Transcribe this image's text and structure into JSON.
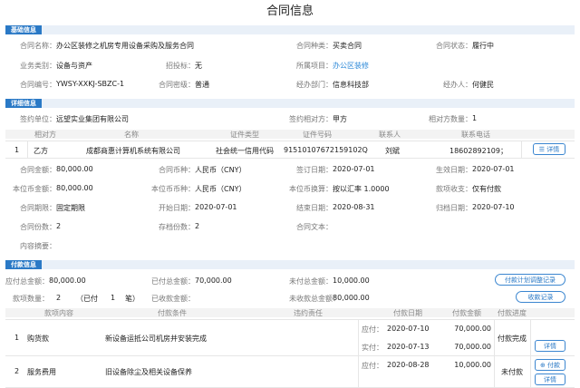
{
  "page_title": "合同信息",
  "sections": {
    "basic": "基础信息",
    "detail": "详细信息",
    "payment": "付款信息"
  },
  "basic": {
    "contract_name_label": "合同名称：",
    "contract_name": "办公区装修之机房专用设备采购及服务合同",
    "contract_type_label": "合同种类：",
    "contract_type": "买卖合同",
    "contract_status_label": "合同状态：",
    "contract_status": "履行中",
    "business_type_label": "业务类别：",
    "business_type": "设备与资产",
    "bid_label": "招投标：",
    "bid": "无",
    "project_label": "所属项目：",
    "project": "办公区装修",
    "contract_no_label": "合同编号：",
    "contract_no": "YWSY-XXKJ-SBZC-1",
    "secret_label": "合同密级：",
    "secret": "普通",
    "dept_label": "经办部门：",
    "dept": "信息科技部",
    "handler_label": "经办人：",
    "handler": "何健民"
  },
  "detail": {
    "sign_unit_label": "签约单位：",
    "sign_unit": "远望实业集团有限公司",
    "sign_party_label": "签约相对方：",
    "sign_party": "甲方",
    "counterparty_count_label": "相对方数量：",
    "counterparty_count": "1",
    "table_headers": [
      "相对方",
      "名称",
      "证件类型",
      "证件号码",
      "联系人",
      "联系电话"
    ],
    "table_row": {
      "index": "1",
      "party": "乙方",
      "name": "成都商惠计算机系统有限公司",
      "id_type": "社会统一信用代码",
      "id_no": "91510107672159102Q",
      "contact": "刘斌",
      "phone": "18602892109；",
      "detail_btn": "详情"
    },
    "fields": [
      {
        "label": "合同金额：",
        "value": "80,000.00"
      },
      {
        "label": "合同币种：",
        "value": "人民币（CNY）"
      },
      {
        "label": "签订日期：",
        "value": "2020-07-01"
      },
      {
        "label": "生效日期：",
        "value": "2020-07-01"
      },
      {
        "label": "本位币金额：",
        "value": "80,000.00"
      },
      {
        "label": "本位币币种：",
        "value": "人民币（CNY）"
      },
      {
        "label": "本位币换算：",
        "value": "按以汇率 1.0000"
      },
      {
        "label": "款项收支：",
        "value": "仅有付款"
      },
      {
        "label": "合同期限：",
        "value": "固定期限"
      },
      {
        "label": "开始日期：",
        "value": "2020-07-01"
      },
      {
        "label": "结束日期：",
        "value": "2020-08-31"
      },
      {
        "label": "归档日期：",
        "value": "2020-07-10"
      },
      {
        "label": "合同份数：",
        "value": "2"
      },
      {
        "label": "存档份数：",
        "value": "2"
      },
      {
        "label": "合同文本：",
        "value": ""
      }
    ],
    "content_summary_label": "内容摘要："
  },
  "payment": {
    "payable_total_label": "应付总金额：",
    "payable_total": "80,000.00",
    "paid_total_label": "已付总金额：",
    "paid_total": "70,000.00",
    "unpaid_total_label": "未付总金额：",
    "unpaid_total": "10,000.00",
    "plan_adjust_btn": "付款计划调整记录",
    "item_count_label": "款项数量：",
    "item_count": "2",
    "paid_prefix": "（已付",
    "paid_count": "1",
    "paid_suffix": "笔）",
    "received_total_label": "已收款金额：",
    "received_total": "",
    "unreceived_total_label": "未收款总金额：",
    "unreceived_total": "80,000.00",
    "receipt_btn": "收款记录",
    "table_headers": [
      "款项内容",
      "付款条件",
      "违约责任",
      "付款日期",
      "付款金额",
      "付款进度"
    ],
    "rows": [
      {
        "index": "1",
        "content": "购货款",
        "condition": "新设备运抵公司机房并安装完成",
        "due_label": "应付：",
        "due_date": "2020-07-10",
        "due_amount": "70,000.00",
        "actual_label": "实付：",
        "actual_date": "2020-07-13",
        "actual_amount": "70,000.00",
        "progress": "付款完成",
        "detail_btn": "详情"
      },
      {
        "index": "2",
        "content": "服务费用",
        "condition": "旧设备除尘及相关设备保养",
        "due_label": "应付：",
        "due_date": "2020-08-28",
        "due_amount": "10,000.00",
        "progress": "未付款",
        "pay_btn": "付款",
        "detail_btn": "详情"
      }
    ]
  }
}
